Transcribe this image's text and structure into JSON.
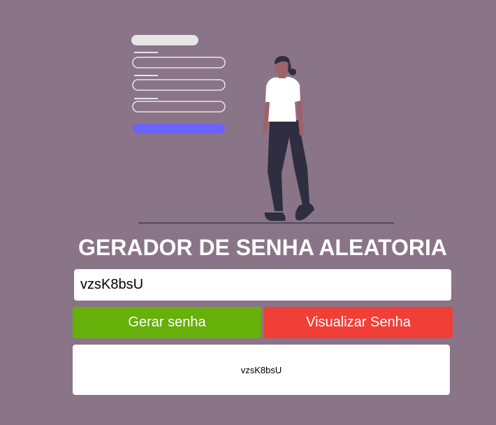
{
  "title": "GERADOR DE SENHA ALEATORIA",
  "password_field": {
    "value": "vzsK8bsU"
  },
  "buttons": {
    "generate_label": "Gerar senha",
    "view_label": "Visualizar Senha"
  },
  "result": {
    "text": "vzsK8bsU"
  },
  "colors": {
    "background": "#8a7488",
    "generate_button": "#67b009",
    "view_button": "#f13e37",
    "illustration_accent": "#6c63ff"
  },
  "illustration": {
    "icon": "person-login-form-illustration"
  }
}
